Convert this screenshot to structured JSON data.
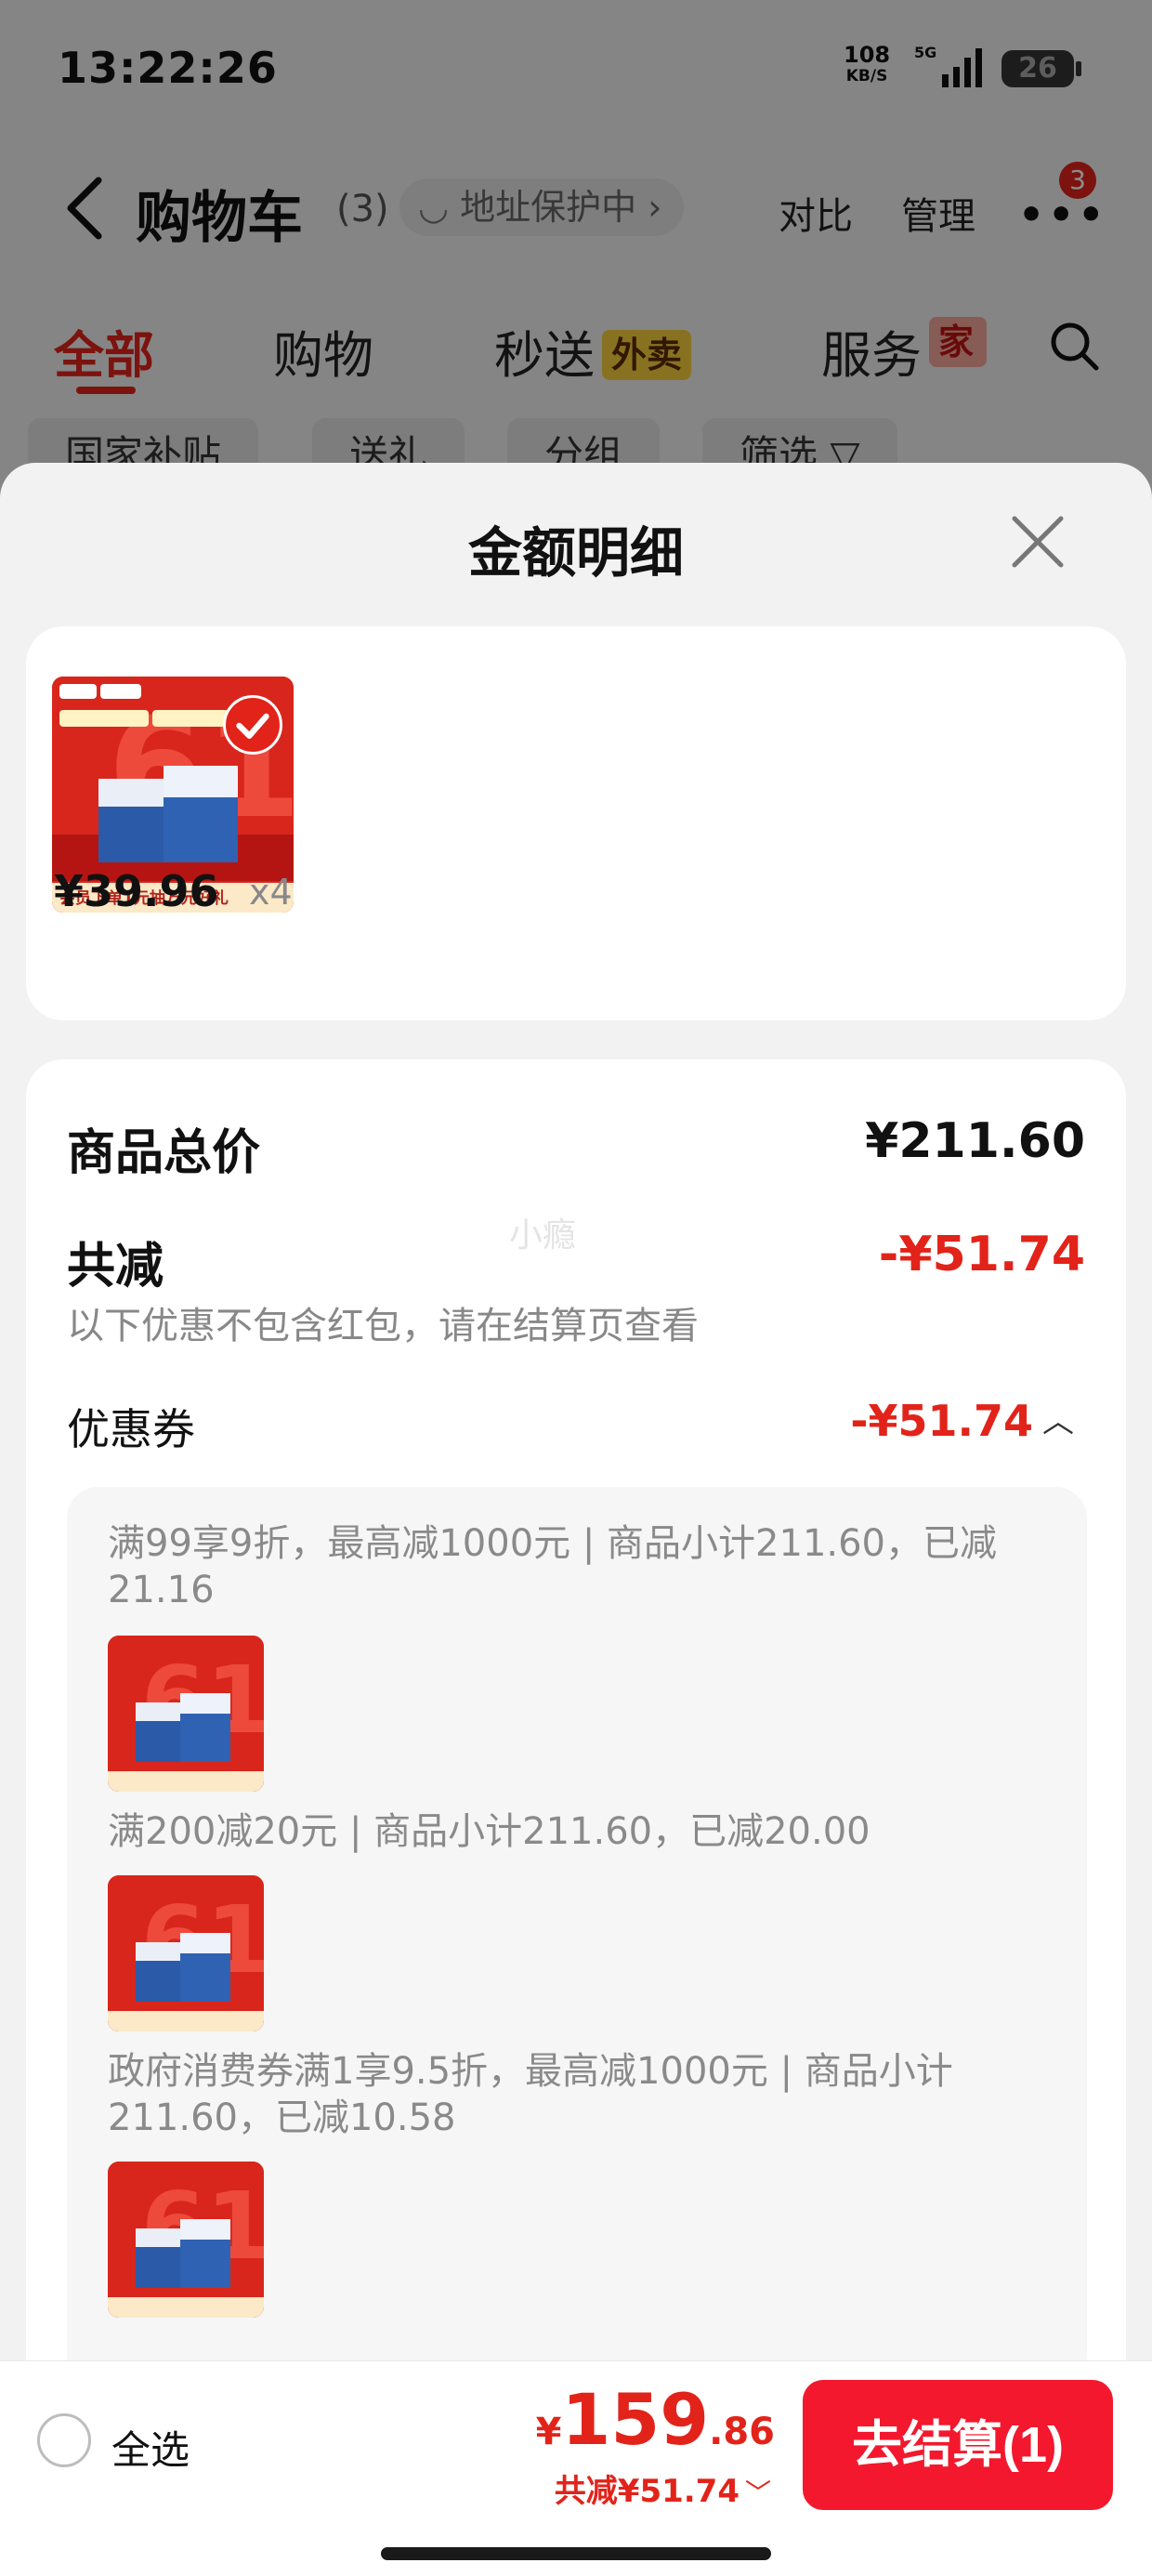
{
  "status_bar": {
    "time": "13:22:26",
    "net_speed": "108",
    "net_unit": "KB/S",
    "battery": "26"
  },
  "nav": {
    "title": "购物车",
    "count": "(3)",
    "address_protection": "地址保护中",
    "compare": "对比",
    "manage": "管理",
    "more_badge": "3"
  },
  "tabs": {
    "all": "全部",
    "shopping": "购物",
    "seconds": "秒送",
    "seconds_tag": "外卖",
    "service": "服务",
    "service_tag": "家"
  },
  "chips": [
    "国家补贴",
    "送礼",
    "分组",
    "筛选"
  ],
  "sheet": {
    "title": "金额明细",
    "product": {
      "thumbnail_text": "会员下单1元抽万元好礼",
      "price": "¥39.96",
      "quantity": "x4"
    },
    "total_label": "商品总价",
    "total_value": "¥211.60",
    "reduce_label": "共减",
    "reduce_value": "-¥51.74",
    "reduce_note": "以下优惠不包含红包，请在结算页查看",
    "watermark": "小瘾",
    "coupon_label": "优惠券",
    "coupon_value": "-¥51.74",
    "coupons": [
      {
        "text": "满99享9折，最高减1000元 | 商品小计211.60，已减21.16"
      },
      {
        "text": "满200减20元 | 商品小计211.60，已减20.00"
      },
      {
        "text": "政府消费券满1享9.5折，最高减1000元 | 商品小计211.60，已减10.58"
      }
    ]
  },
  "bottom": {
    "select_all": "全选",
    "currency": "¥",
    "total_int": "159",
    "total_dec": ".86",
    "discount": "共减¥51.74",
    "checkout": "去结算(1)"
  },
  "colors": {
    "accent_red": "#e2231a",
    "checkout_red": "#f3182e",
    "tag_yellow": "#f7cf3e"
  }
}
